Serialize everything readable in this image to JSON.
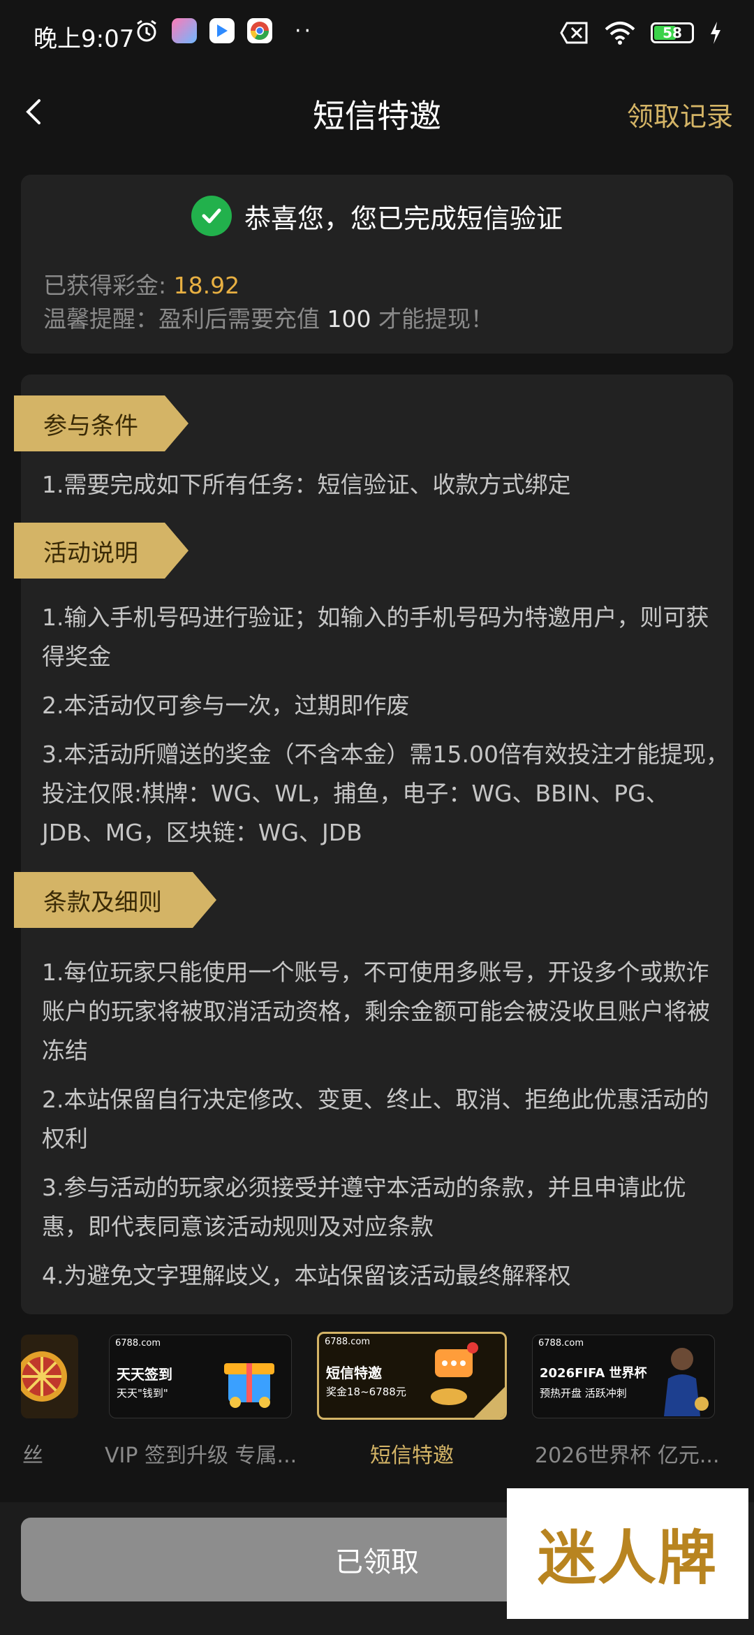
{
  "status_bar": {
    "time": "晚上9:07",
    "battery": "58"
  },
  "header": {
    "title": "短信特邀",
    "record_link": "领取记录"
  },
  "verify": {
    "message": "恭喜您，您已完成短信验证",
    "bonus_label": "已获得彩金: ",
    "bonus_value": "18.92",
    "tip_prefix": "温馨提醒：盈利后需要充值 ",
    "tip_amount": "100",
    "tip_suffix": " 才能提现！"
  },
  "sections": {
    "conditions": {
      "title": "参与条件",
      "items": [
        "1.需要完成如下所有任务：短信验证、收款方式绑定"
      ]
    },
    "description": {
      "title": "活动说明",
      "items": [
        "1.输入手机号码进行验证；如输入的手机号码为特邀用户，则可获得奖金",
        "2.本活动仅可参与一次，过期即作废",
        "3.本活动所赠送的奖金（不含本金）需15.00倍有效投注才能提现，投注仅限:棋牌：WG、WL，捕鱼，电子：WG、BBIN、PG、JDB、MG，区块链：WG、JDB"
      ]
    },
    "terms": {
      "title": "条款及细则",
      "items": [
        "1.每位玩家只能使用一个账号，不可使用多账号，开设多个或欺诈账户的玩家将被取消活动资格，剩余金额可能会被没收且账户将被冻结",
        "2.本站保留自行决定修改、变更、终止、取消、拒绝此优惠活动的权利",
        "3.参与活动的玩家必须接受并遵守本活动的条款，并且申请此优惠，即代表同意该活动规则及对应条款",
        "4.为避免文字理解歧义，本站保留该活动最终解释权"
      ]
    }
  },
  "tabs": [
    {
      "label": "丝",
      "banner": {
        "brand": "",
        "line1": "",
        "line2": ""
      }
    },
    {
      "label": "VIP 签到升级 专属...",
      "banner": {
        "brand": "6788.com",
        "line1": "天天签到",
        "line2": "天天\"钱到\""
      }
    },
    {
      "label": "短信特邀",
      "banner": {
        "brand": "6788.com",
        "line1": "短信特邀",
        "line2": "奖金18~6788元"
      }
    },
    {
      "label": "2026世界杯 亿元...",
      "banner": {
        "brand": "6788.com",
        "line1": "2026FIFA 世界杯",
        "line2": "预热开盘 活跃冲刺"
      }
    }
  ],
  "bottom": {
    "claim_button": "已领取"
  },
  "watermark": {
    "text": "迷人牌"
  },
  "colors": {
    "accent": "#d4b466",
    "bonus": "#e8b042",
    "success": "#22b14c",
    "bg": "#141414",
    "card": "#222222"
  }
}
